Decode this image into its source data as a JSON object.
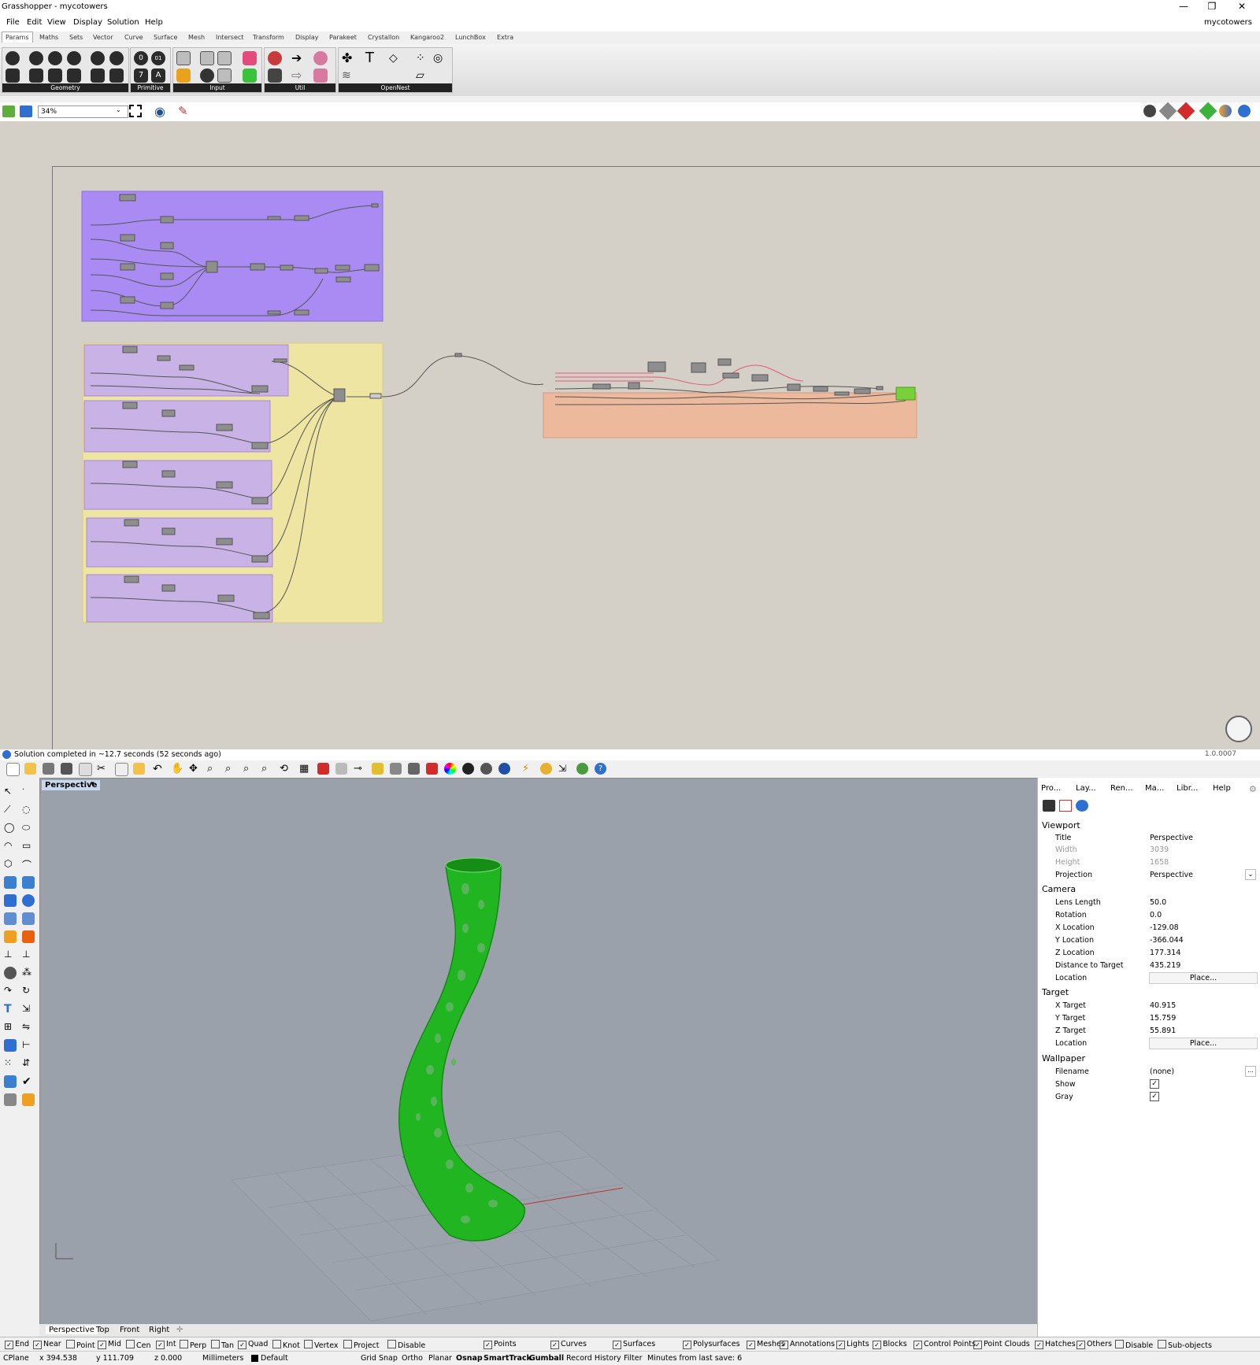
{
  "window": {
    "title": "Grasshopper - mycotowers",
    "doc_name": "mycotowers",
    "controls": [
      "—",
      "❐",
      "✕"
    ]
  },
  "menu": [
    "File",
    "Edit",
    "View",
    "Display",
    "Solution",
    "Help"
  ],
  "gh_tabs": [
    "Params",
    "Maths",
    "Sets",
    "Vector",
    "Curve",
    "Surface",
    "Mesh",
    "Intersect",
    "Transform",
    "Display",
    "Parakeet",
    "Crystallon",
    "Kangaroo2",
    "LunchBox",
    "Extra"
  ],
  "ribbon_groups": [
    "Geometry",
    "Primitive",
    "Input",
    "Util",
    "OpenNest"
  ],
  "primitive_glyphs": [
    "0",
    "01",
    "7",
    "A"
  ],
  "zoom": "34%",
  "gh_status": {
    "message": "Solution completed in ~12.7 seconds (52 seconds ago)",
    "version": "1.0.0007"
  },
  "viewport": {
    "title": "Perspective",
    "tabs": [
      "Perspective",
      "Top",
      "Front",
      "Right"
    ]
  },
  "panel_tabs": [
    "Pro...",
    "Lay...",
    "Ren...",
    "Ma...",
    "Libr...",
    "Help"
  ],
  "properties": {
    "viewport_header": "Viewport",
    "title_label": "Title",
    "title_value": "Perspective",
    "width_label": "Width",
    "width_value": "3039",
    "height_label": "Height",
    "height_value": "1658",
    "projection_label": "Projection",
    "projection_value": "Perspective",
    "camera_header": "Camera",
    "lens_label": "Lens Length",
    "lens_value": "50.0",
    "rotation_label": "Rotation",
    "rotation_value": "0.0",
    "xloc_label": "X Location",
    "xloc_value": "-129.08",
    "yloc_label": "Y Location",
    "yloc_value": "-366.044",
    "zloc_label": "Z Location",
    "zloc_value": "177.314",
    "dist_label": "Distance to Target",
    "dist_value": "435.219",
    "location_label": "Location",
    "place_label": "Place...",
    "target_header": "Target",
    "xt_label": "X Target",
    "xt_value": "40.915",
    "yt_label": "Y Target",
    "yt_value": "15.759",
    "zt_label": "Z Target",
    "zt_value": "55.891",
    "wallpaper_header": "Wallpaper",
    "filename_label": "Filename",
    "filename_value": "(none)",
    "show_label": "Show",
    "gray_label": "Gray",
    "ellipsis": "..."
  },
  "osnap": [
    "End",
    "Near",
    "Point",
    "Mid",
    "Cen",
    "Int",
    "Perp",
    "Tan",
    "Quad",
    "Knot",
    "Vertex",
    "Project",
    "Disable"
  ],
  "osnap_checked": [
    true,
    true,
    false,
    true,
    false,
    true,
    false,
    false,
    true,
    false,
    false,
    false,
    false
  ],
  "selection_filters": [
    "Points",
    "Curves",
    "Surfaces",
    "Polysurfaces",
    "Meshes",
    "Annotations",
    "Lights",
    "Blocks",
    "Control Points",
    "Point Clouds",
    "Hatches",
    "Others",
    "Disable",
    "Sub-objects"
  ],
  "status": {
    "cplane": "CPlane",
    "x": "x 394.538",
    "y": "y 111.709",
    "z": "z 0.000",
    "units": "Millimeters",
    "layer": "Default",
    "grid_snap": "Grid Snap",
    "ortho": "Ortho",
    "planar": "Planar",
    "osnap": "Osnap",
    "smarttrack": "SmartTrack",
    "gumball": "Gumball",
    "record_history": "Record History",
    "filter": "Filter",
    "minutes": "Minutes from last save: 6"
  },
  "colors": {
    "purple_group": "#a98bf3",
    "yellow_group": "#eee5a2",
    "salmon_group": "#ecb99c",
    "mesh_green": "#22b522",
    "viewport_bg": "#9aa1ab",
    "canvas_bg": "#d4d0c8"
  }
}
